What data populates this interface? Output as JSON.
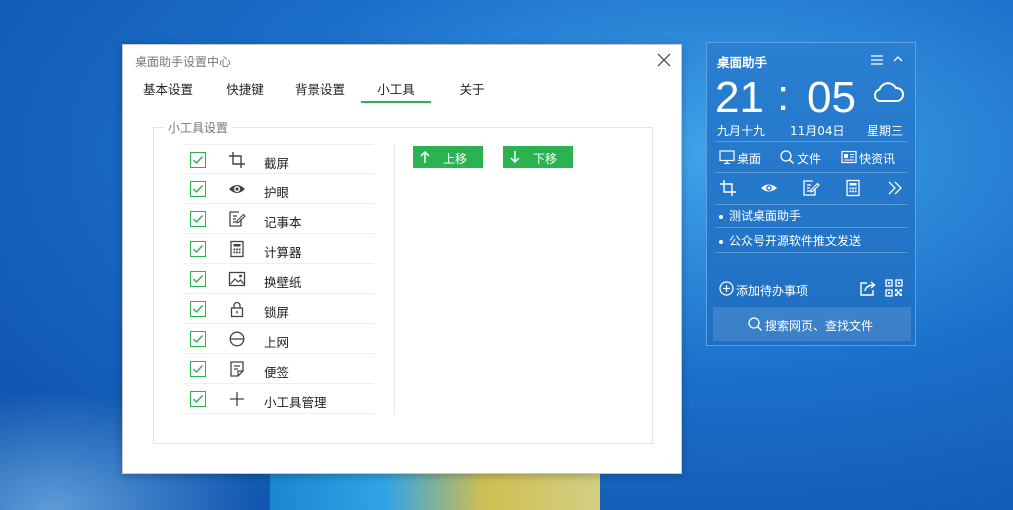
{
  "settings": {
    "title": "桌面助手设置中心",
    "tabs": [
      {
        "label": "基本设置"
      },
      {
        "label": "快捷键"
      },
      {
        "label": "背景设置"
      },
      {
        "label": "小工具",
        "active": true
      },
      {
        "label": "关于"
      }
    ],
    "group_label": "小工具设置",
    "tools": [
      {
        "label": "截屏",
        "icon": "crop-icon",
        "checked": true
      },
      {
        "label": "护眼",
        "icon": "eye-icon",
        "checked": true
      },
      {
        "label": "记事本",
        "icon": "notepad-icon",
        "checked": true
      },
      {
        "label": "计算器",
        "icon": "calculator-icon",
        "checked": true
      },
      {
        "label": "换壁纸",
        "icon": "wallpaper-icon",
        "checked": true
      },
      {
        "label": "锁屏",
        "icon": "lock-icon",
        "checked": true
      },
      {
        "label": "上网",
        "icon": "globe-icon",
        "checked": true
      },
      {
        "label": "便签",
        "icon": "sticky-note-icon",
        "checked": true
      },
      {
        "label": "小工具管理",
        "icon": "plus-icon",
        "checked": true
      }
    ],
    "move_up_label": "上移",
    "move_down_label": "下移",
    "accent_color": "#2bb352"
  },
  "widget": {
    "title": "桌面助手",
    "time": {
      "hours": "21",
      "colon": ":",
      "minutes": "05"
    },
    "lunar_date": "九月十九",
    "date": "11月04日",
    "weekday": "星期三",
    "weather_icon": "cloud-icon",
    "nav": [
      {
        "label": "桌面",
        "icon": "monitor-icon"
      },
      {
        "label": "文件",
        "icon": "search-icon"
      },
      {
        "label": "快资讯",
        "icon": "news-icon"
      }
    ],
    "tools": [
      "crop-icon",
      "eye-icon",
      "notepad-icon",
      "calculator-icon",
      "more-icon"
    ],
    "news": [
      "测试桌面助手",
      "公众号开源软件推文发送"
    ],
    "add_todo_label": "添加待办事项",
    "search_label": "搜索网页、查找文件",
    "background_color": "#2276c8"
  }
}
